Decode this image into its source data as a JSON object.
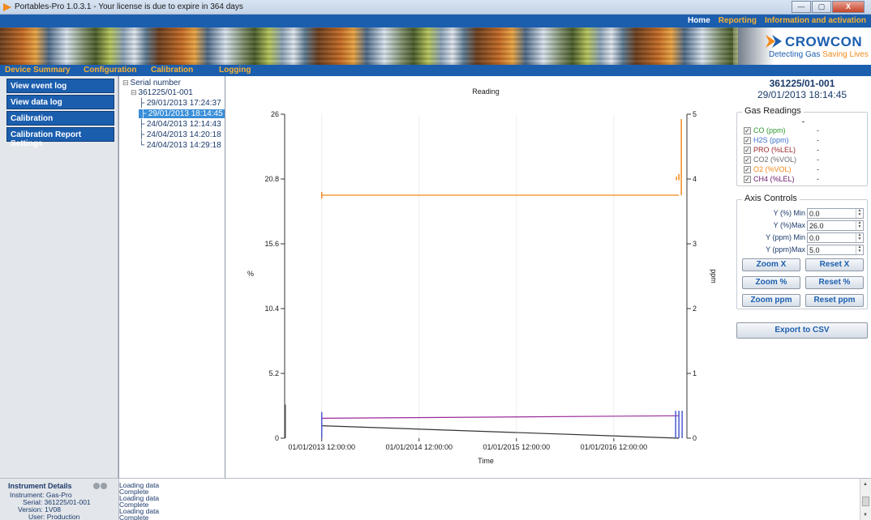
{
  "window": {
    "title": "Portables-Pro 1.0.3.1 - Your license is due to expire in 364 days",
    "minimize": "—",
    "maximize": "▢",
    "close": "X"
  },
  "topnav": [
    "Home",
    "Reporting",
    "Information and activation"
  ],
  "brand": {
    "name": "CROWCON",
    "tagline_a": "Detecting Gas ",
    "tagline_b": "Saving Lives"
  },
  "mainmenu": [
    "Device Summary",
    "Configuration",
    "Calibration",
    "Logging"
  ],
  "leftnav": [
    "View event log",
    "View data log",
    "Calibration",
    "Calibration Report Settings"
  ],
  "tree": {
    "root": "Serial number",
    "device": "361225/01-001",
    "sessions": [
      "29/01/2013 17:24:37",
      "29/01/2013 18:14:45",
      "24/04/2013 12:14:43",
      "24/04/2013 14:20:18",
      "24/04/2013 14:29:18"
    ],
    "selected_index": 1
  },
  "chart_data": {
    "type": "line",
    "title": "Reading",
    "xlabel": "Time",
    "ylabel_left": "%",
    "ylabel_right": "ppm",
    "x_ticks": [
      "01/01/2013 12:00:00",
      "01/01/2014 12:00:00",
      "01/01/2015 12:00:00",
      "01/01/2016 12:00:00"
    ],
    "y_left_ticks": [
      "0",
      "5.2",
      "10.4",
      "15.6",
      "20.8",
      "26"
    ],
    "y_right_ticks": [
      "0",
      "1",
      "2",
      "3",
      "4",
      "5"
    ],
    "ylim_left": [
      0,
      26
    ],
    "ylim_right": [
      0,
      5
    ],
    "xlim": [
      "2012-08-15",
      "2016-10-01"
    ],
    "series": [
      {
        "name": "O2 (%VOL)",
        "color": "#f28a1c",
        "points": [
          [
            "2013-01-01",
            19.5
          ],
          [
            "2016-09-01",
            19.5
          ]
        ]
      },
      {
        "name": "PRO (%LEL)",
        "color": "#9b2a9b",
        "points": [
          [
            "2013-01-01",
            1.6
          ],
          [
            "2016-09-01",
            1.8
          ]
        ]
      },
      {
        "name": "CH4 (%LEL)",
        "color": "#333333",
        "points": [
          [
            "2013-01-01",
            1.0
          ],
          [
            "2016-09-01",
            0.0
          ]
        ]
      }
    ],
    "grid": "vertical"
  },
  "instrument": {
    "serial": "361225/01-001",
    "time": "29/01/2013 18:14:45"
  },
  "gas_readings": {
    "title": "Gas Readings",
    "header": "-",
    "items": [
      {
        "label": "CO (ppm)",
        "value": "-",
        "color": "#2e9a2e"
      },
      {
        "label": "H2S (ppm)",
        "value": "-",
        "color": "#3b6fc9"
      },
      {
        "label": "PRO (%LEL)",
        "value": "-",
        "color": "#9b2a2a"
      },
      {
        "label": "CO2 (%VOL)",
        "value": "-",
        "color": "#6b6b6b"
      },
      {
        "label": "O2 (%VOL)",
        "value": "-",
        "color": "#f28a1c"
      },
      {
        "label": "CH4 (%LEL)",
        "value": "-",
        "color": "#6a1a6a"
      }
    ]
  },
  "axis_controls": {
    "title": "Axis Controls",
    "fields": [
      {
        "label": "Y (%) Min",
        "value": "0.0"
      },
      {
        "label": "Y (%)Max",
        "value": "26.0"
      },
      {
        "label": "Y (ppm) Min",
        "value": "0.0"
      },
      {
        "label": "Y (ppm)Max",
        "value": "5.0"
      }
    ],
    "buttons": [
      "Zoom X",
      "Reset X",
      "Zoom %",
      "Reset %",
      "Zoom ppm",
      "Reset ppm"
    ]
  },
  "export_label": "Export to CSV",
  "instrument_details": {
    "title": "Instrument Details",
    "rows": [
      {
        "k": "Instrument:",
        "v": "Gas-Pro"
      },
      {
        "k": "Serial:",
        "v": "361225/01-001"
      },
      {
        "k": "Version:",
        "v": "1V08"
      },
      {
        "k": "User:",
        "v": "Production"
      }
    ]
  },
  "log_lines": [
    "Loading data",
    "Complete",
    "Loading data",
    "Complete",
    "Loading data",
    "Complete"
  ]
}
